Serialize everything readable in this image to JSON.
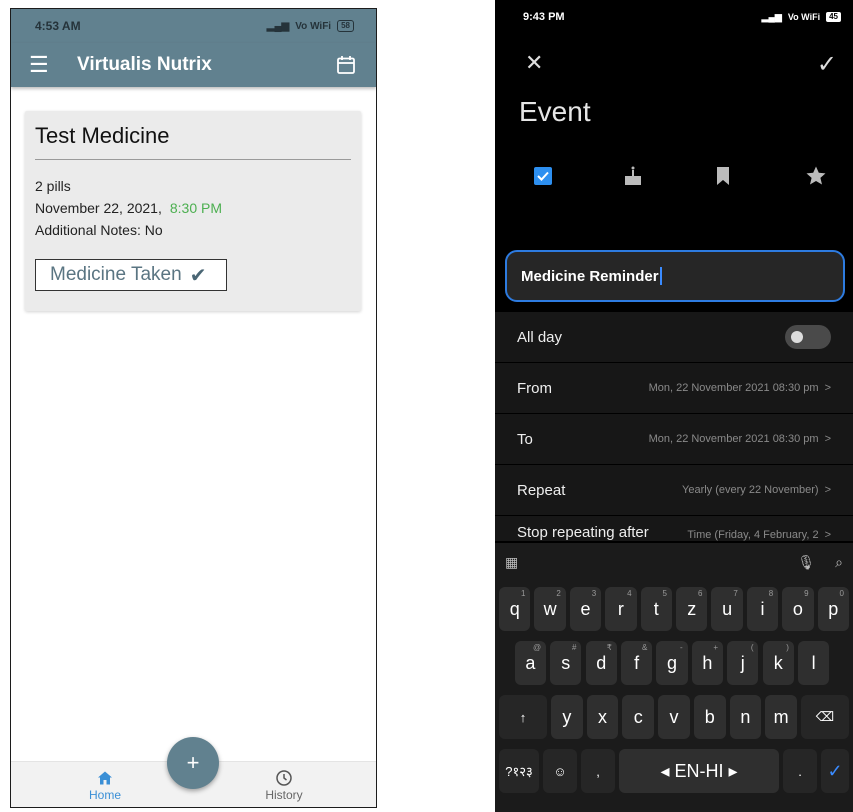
{
  "left": {
    "status": {
      "time": "4:53 AM",
      "network": "Vo WiFi",
      "battery": "58"
    },
    "appbar": {
      "title": "Virtualis Nutrix"
    },
    "card": {
      "name": "Test Medicine",
      "dose": "2 pills",
      "date": "November 22, 2021,",
      "time": "8:30 PM",
      "notes": "Additional Notes: No",
      "button_label": "Medicine Taken",
      "check": "✔"
    },
    "fab_label": "+",
    "nav": {
      "home": "Home",
      "history": "History"
    },
    "colors": {
      "primary": "#61818f",
      "active": "#3a8fd6",
      "time_green": "#4caf50"
    }
  },
  "right": {
    "status": {
      "time": "9:43 PM",
      "network": "Vo WiFi",
      "battery": "45"
    },
    "toolbar": {
      "close": "✕",
      "confirm": "✓"
    },
    "heading": "Event",
    "event_title": "Medicine Reminder",
    "rows": {
      "allday": {
        "label": "All day"
      },
      "from": {
        "label": "From",
        "value": "Mon, 22 November 2021 08:30 pm"
      },
      "to": {
        "label": "To",
        "value": "Mon, 22 November 2021 08:30 pm"
      },
      "repeat": {
        "label": "Repeat",
        "value": "Yearly (every 22 November)"
      },
      "stop": {
        "label": "Stop repeating after",
        "value": "Time (Friday, 4 February, 2"
      }
    },
    "chevron": ">",
    "keyboard": {
      "row1": [
        "q",
        "w",
        "e",
        "r",
        "t",
        "z",
        "u",
        "i",
        "o",
        "p"
      ],
      "row1_hints": [
        "1",
        "2",
        "3",
        "4",
        "5",
        "6",
        "7",
        "8",
        "9",
        "0"
      ],
      "row2": [
        "a",
        "s",
        "d",
        "f",
        "g",
        "h",
        "j",
        "k",
        "l"
      ],
      "row2_hints": [
        "@",
        "#",
        "₹",
        "&",
        "-",
        "+",
        "(",
        ")",
        ""
      ],
      "row3": [
        "y",
        "x",
        "c",
        "v",
        "b",
        "n",
        "m"
      ],
      "shift": "↑",
      "backspace": "⌫",
      "symbols": "?१२३",
      "emoji": "☺",
      "comma": ",",
      "space": "◂ EN-HI ▸",
      "period": ".",
      "enter": "✓"
    },
    "colors": {
      "accent": "#2d7be0",
      "bg": "#000000",
      "row_bg": "#171717"
    }
  }
}
